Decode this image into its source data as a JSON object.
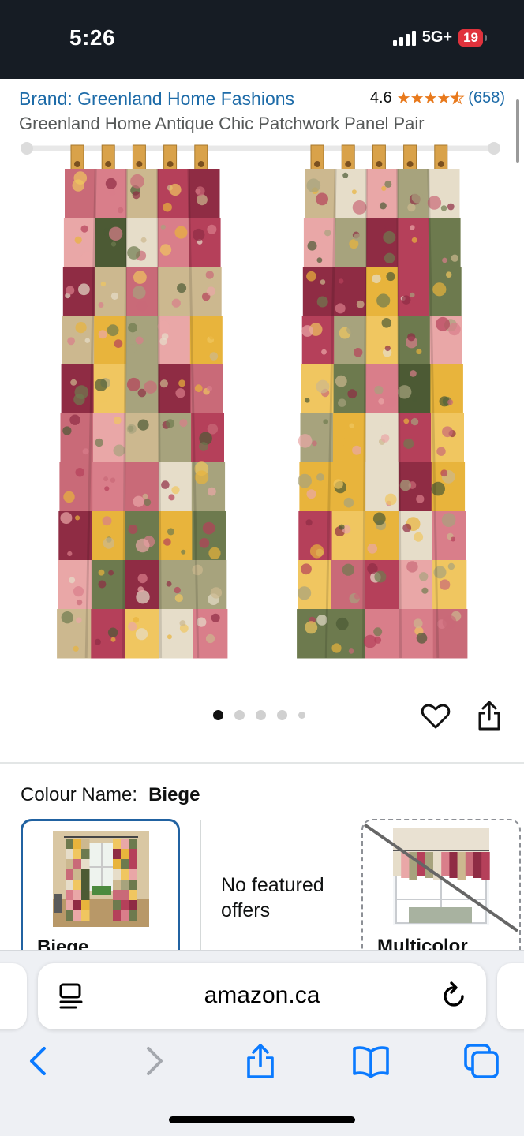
{
  "status_bar": {
    "time": "5:26",
    "network": "5G+",
    "battery": "19"
  },
  "product": {
    "brand_link": "Brand: Greenland Home Fashions",
    "rating_value": "4.6",
    "rating_stars": 4.6,
    "review_count": "(658)",
    "title": "Greenland Home Antique Chic Patchwork Panel Pair"
  },
  "carousel": {
    "image_count": 5,
    "active_index": 0
  },
  "colour": {
    "label": "Colour Name:",
    "selected": "Biege",
    "options": [
      {
        "name": "Biege",
        "selected": true
      },
      {
        "name": "No featured offers"
      },
      {
        "name": "Multicolor",
        "unavailable": true
      }
    ]
  },
  "browser": {
    "url": "amazon.ca"
  },
  "colors": {
    "link": "#1d6ba8",
    "star": "#e8791c",
    "selected_border": "#2162a1",
    "ios_blue": "#0a7aff"
  }
}
